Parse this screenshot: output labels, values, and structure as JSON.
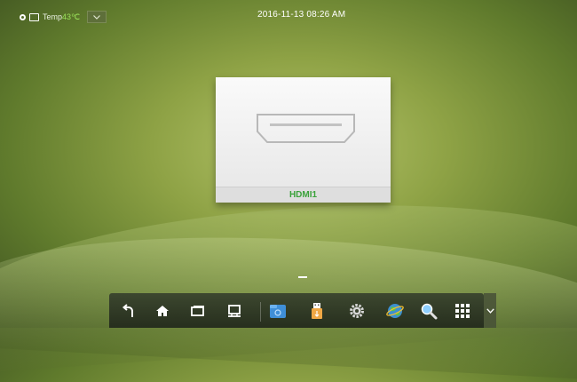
{
  "status_bar": {
    "temp_label": "Temp",
    "temp_value": "43℃",
    "datetime": "2016-11-13 08:26 AM"
  },
  "source_card": {
    "label": "HDMI1",
    "icon": "hdmi-port-icon"
  },
  "taskbar": {
    "buttons": [
      {
        "icon": "back-icon"
      },
      {
        "icon": "home-icon"
      },
      {
        "icon": "recent-apps-icon"
      },
      {
        "icon": "display-icon"
      },
      {
        "icon": "file-manager-icon"
      },
      {
        "icon": "usb-icon"
      },
      {
        "icon": "settings-icon"
      },
      {
        "icon": "browser-icon"
      },
      {
        "icon": "search-icon"
      },
      {
        "icon": "apps-grid-icon"
      }
    ],
    "expand_icon": "chevron-down-icon"
  },
  "colors": {
    "accent_green": "#3aa23a",
    "temp_green": "#9be35a",
    "taskbar_bg": "#2e3526"
  }
}
